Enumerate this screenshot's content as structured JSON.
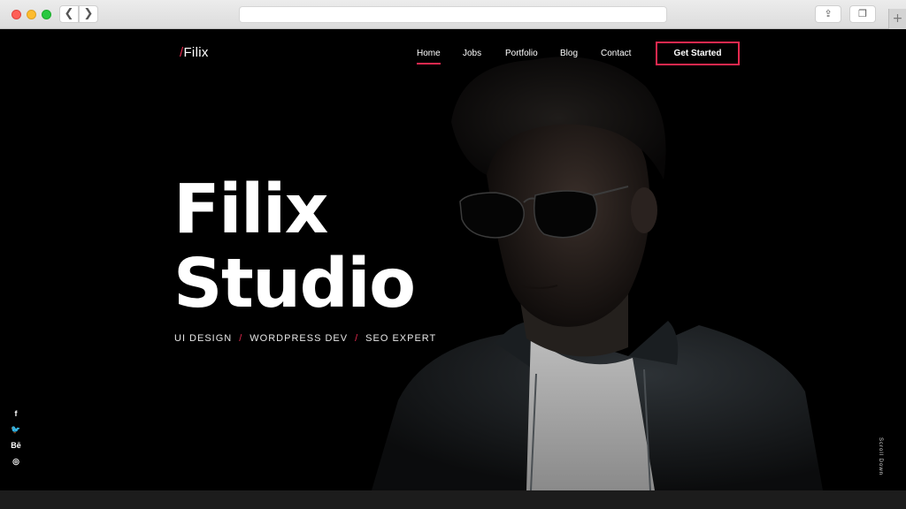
{
  "browser": {
    "back_icon": "chevron-left-icon",
    "forward_icon": "chevron-right-icon",
    "back_glyph": "❮",
    "forward_glyph": "❯",
    "share_glyph": "⇪",
    "tabs_glyph": "❐",
    "plus_glyph": "+"
  },
  "colors": {
    "accent": "#e8294f",
    "background": "#000000",
    "text": "#ffffff"
  },
  "header": {
    "logo_slash": "/",
    "logo_text": "Filix",
    "nav": [
      "Home",
      "Jobs",
      "Portfolio",
      "Blog",
      "Contact"
    ],
    "cta": "Get Started"
  },
  "hero": {
    "title_line1": "Filix",
    "title_line2": "Studio",
    "tags": [
      "UI DESIGN",
      "WORDPRESS DEV",
      "SEO EXPERT"
    ],
    "tag_separator": "/",
    "scroll_label": "Scroll Down"
  },
  "social": [
    {
      "icon": "facebook-icon",
      "glyph": "f"
    },
    {
      "icon": "twitter-icon",
      "glyph": "🐦"
    },
    {
      "icon": "behance-icon",
      "glyph": "Bē"
    },
    {
      "icon": "instagram-icon",
      "glyph": "◎"
    }
  ]
}
